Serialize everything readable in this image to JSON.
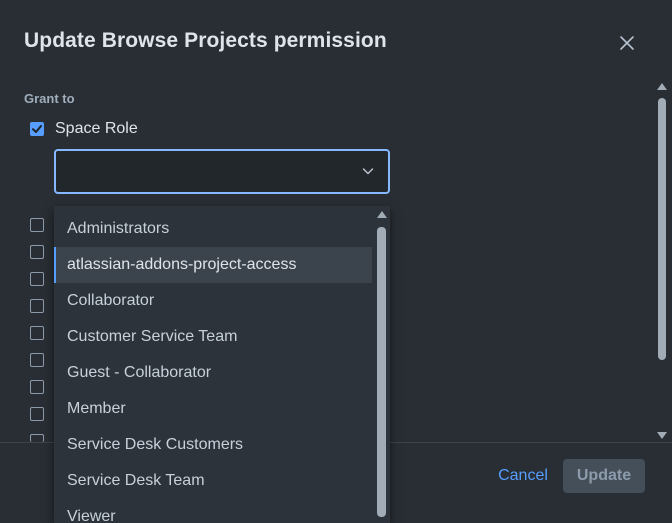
{
  "dialog": {
    "title": "Update Browse Projects permission",
    "grant_to_label": "Grant to",
    "space_role_label": "Space Role",
    "space_role_checked": true,
    "select_value": "",
    "cancel_label": "Cancel",
    "update_label": "Update"
  },
  "dropdown": {
    "options": [
      "Administrators",
      "atlassian-addons-project-access",
      "Collaborator",
      "Customer Service Team",
      "Guest - Collaborator",
      "Member",
      "Service Desk Customers",
      "Service Desk Team",
      "Viewer"
    ],
    "highlighted": "atlassian-addons-project-access"
  },
  "colors": {
    "accent": "#579dff",
    "background": "#282e33",
    "menu_background": "#2c333a"
  },
  "icons": [
    "close-icon",
    "check-icon",
    "chevron-down-icon",
    "scroll-up-arrow-icon",
    "scroll-down-arrow-icon"
  ]
}
